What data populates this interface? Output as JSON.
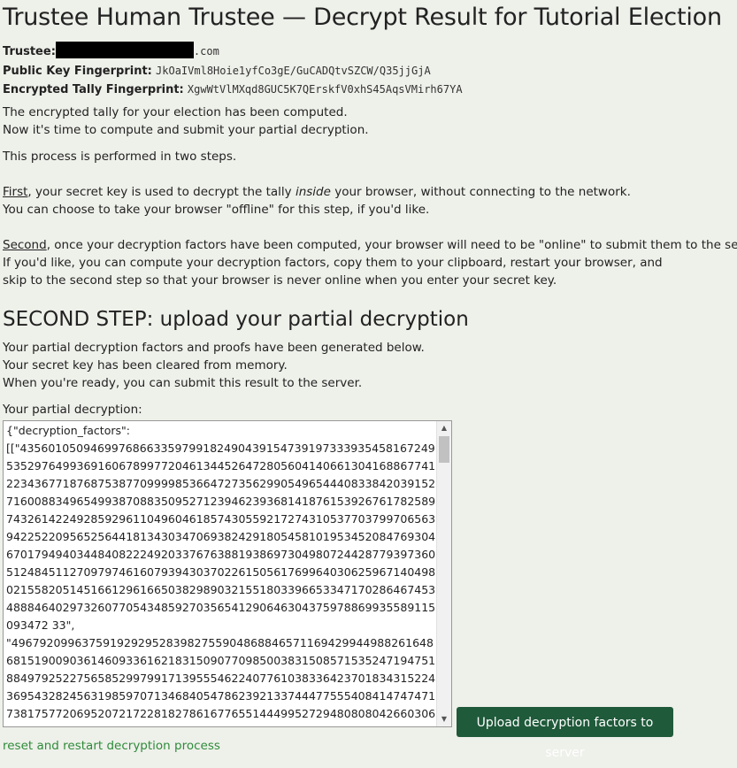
{
  "header": {
    "title": "Trustee Human Trustee — Decrypt Result for Tutorial Election"
  },
  "trustee": {
    "label": "Trustee:",
    "email_suffix": ".com",
    "pk_label": "Public Key Fingerprint:",
    "pk_value": "JkOaIVml8Hoie1yfCo3gE/GuCADQtvSZCW/Q35jjGjA",
    "tally_label": "Encrypted Tally Fingerprint:",
    "tally_value": "XgwWtVlMXqd8GUC5K7QErskfV0xhS45AqsVMirh67YA"
  },
  "intro": {
    "line1": "The encrypted tally for your election has been computed.",
    "line2": "Now it's time to compute and submit your partial decryption.",
    "line3": "This process is performed in two steps.",
    "first_word": "First",
    "first_a": ", your secret key is used to decrypt the tally ",
    "first_em": "inside",
    "first_b": " your browser, without connecting to the network.",
    "first_line2": "You can choose to take your browser \"offline\" for this step, if you'd like.",
    "second_word": "Second",
    "second_a": ", once your decryption factors have been computed, your browser will need to be \"online\" to submit them to the server.",
    "second_line2": "If you'd like, you can compute your decryption factors, copy them to your clipboard, restart your browser, and",
    "second_line3": "skip to the second step so that your browser is never online when you enter your secret key."
  },
  "step2": {
    "heading": "SECOND STEP: upload your partial decryption",
    "line1": "Your partial decryption factors and proofs have been generated below.",
    "line2": "Your secret key has been cleared from memory.",
    "line3": "When you're ready, you can submit this result to the server.",
    "label": "Your partial decryption:",
    "textarea_value": "{\"decryption_factors\":\n[[\"43560105094699768663359799182490439154739197333935458167249535297649936916067899772046134452647280560414066130416886774122343677187687538770999985366472735629905496544408338420391527160088349654993870883509527123946239368141876153926761782589743261422492859296110496046185743055921727431053770379970656394225220956525644181343034706938242918054581019534520847693046701794940344840822249203376763881938697304980724428779397360512484511270979746160793943037022615056176996403062596714049802155820514516612961665038298903215518033966533471702864674534888464029732607705434859270356541290646304375978869935589115093472 33\",\n\"49679209963759192929528398275590486884657116942994498826164868151900903614609336162183150907709850038315085715352471947518849792522756585299799171395554622407761038336423701834315224369543282456319859707134684054786239213374447755540841474747173817577206952072172281827861677655144499527294808080426603063"
  },
  "actions": {
    "upload_label": "Upload decryption factors to server",
    "reset_label": "reset and restart decryption process"
  }
}
